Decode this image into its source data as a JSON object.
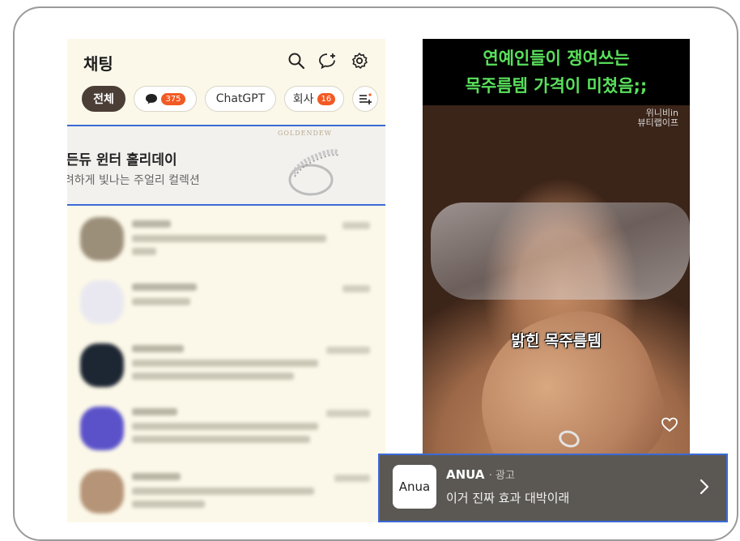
{
  "chat_app": {
    "title": "채팅",
    "icons": [
      "search-icon",
      "add-chat-icon",
      "settings-icon"
    ],
    "filters": [
      {
        "label": "전체",
        "active": true
      },
      {
        "label": "",
        "icon": "open-chat-icon",
        "badge": "375"
      },
      {
        "label": "ChatGPT"
      },
      {
        "label": "회사",
        "badge": "16"
      }
    ],
    "filter_edit_icon": "edit-filter-icon",
    "ad_banner": {
      "title": "골든듀 윈터 홀리데이",
      "subtitle": "화려하게 빛나는 주얼리 컬렉션",
      "brand": "GOLDENDEW"
    },
    "chat_rows_blurred": 5
  },
  "video_ad": {
    "headline_line1": "연예인들이 쟁여쓰는",
    "headline_line2": "목주름템 가격이 미쳤음;;",
    "watermark_line1": "위니비in",
    "watermark_line2": "뷰티랩이프",
    "caption": "밝힌 목주름템",
    "heart_icon": "heart-icon",
    "sponsor": {
      "logo_text": "Anua",
      "name": "ANUA",
      "tag": "· 광고",
      "copy": "이거 진짜 효과 대박이래"
    }
  },
  "colors": {
    "chat_bg": "#fcf8e9",
    "active_chip": "#4a3e37",
    "badge": "#f25a24",
    "headline_green": "#59e05b",
    "highlight_border": "#3b6ad6"
  }
}
